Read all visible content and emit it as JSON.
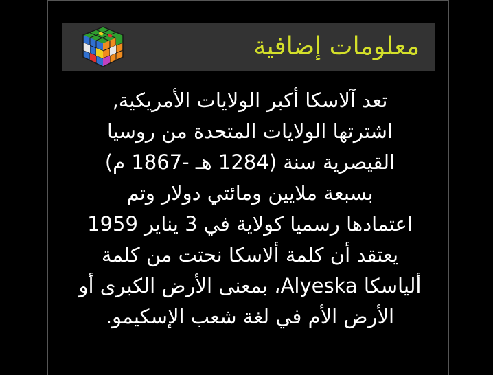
{
  "header": {
    "title": "معلومات إضافية",
    "icon": "rubiks-cube-icon"
  },
  "body": {
    "lines": [
      "تعد آلاسكا أكبر الولايات الأمريكية,",
      "اشترتها الولايات المتحدة من روسيا",
      "القيصرية سنة (1284 هـ -1867 م)",
      "بسبعة ملايين ومائتي دولار وتم",
      "اعتمادها رسميا كولاية في 3 يناير 1959",
      "يعتقد أن كلمة ألاسكا نحتت من كلمة",
      "ألياسكا Alyeska، بمعنى الأرض الكبرى أو",
      "الأرض الأم في لغة شعب الإسكيمو."
    ]
  },
  "colors": {
    "background": "#000000",
    "header_bg": "#333333",
    "title": "#d4e02a",
    "text": "#ffffff"
  }
}
